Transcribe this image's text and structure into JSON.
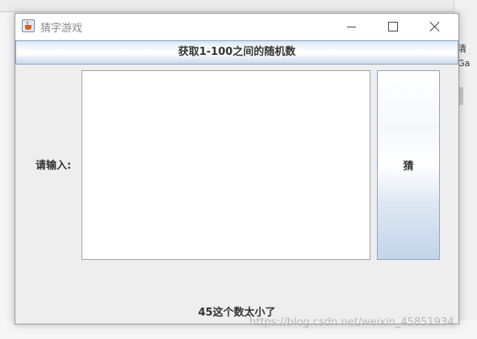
{
  "window": {
    "title": "猜字游戏"
  },
  "top_button": {
    "label": "获取1-100之间的随机数"
  },
  "input": {
    "label": "请输入:",
    "value": ""
  },
  "guess_button": {
    "label": "猜"
  },
  "result": {
    "text": "45这个数太小了"
  },
  "background": {
    "right_fragments": [
      "清",
      "Ga"
    ],
    "watermark": "https://blog.csdn.net/weixin_45851934"
  },
  "colors": {
    "button_border": "#8ea7c5",
    "window_bg": "#eeeeee"
  }
}
